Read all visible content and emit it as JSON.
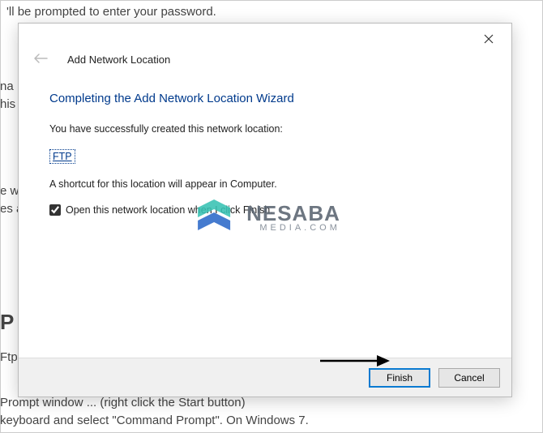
{
  "background": {
    "top": "'ll be prompted to enter your password.",
    "na": "na",
    "his": "his",
    "ew": "e w",
    "es": "es a",
    "p_label": "P",
    "ftp": "Ftp",
    "bottom1": "Prompt window ... (right click the Start button)",
    "bottom2": "keyboard and select \"Command Prompt\". On Windows 7."
  },
  "dialog": {
    "wizard_name": "Add Network Location",
    "heading": "Completing the Add Network Location Wizard",
    "success_text": "You have successfully created this network location:",
    "location_name": "FTP",
    "shortcut_text": "A shortcut for this location will appear in Computer.",
    "checkbox_label": "Open this network location when I click Finish.",
    "checkbox_checked": true,
    "finish_label": "Finish",
    "cancel_label": "Cancel"
  },
  "watermark": {
    "main": "NESABA",
    "sub": "MEDIA.COM"
  }
}
